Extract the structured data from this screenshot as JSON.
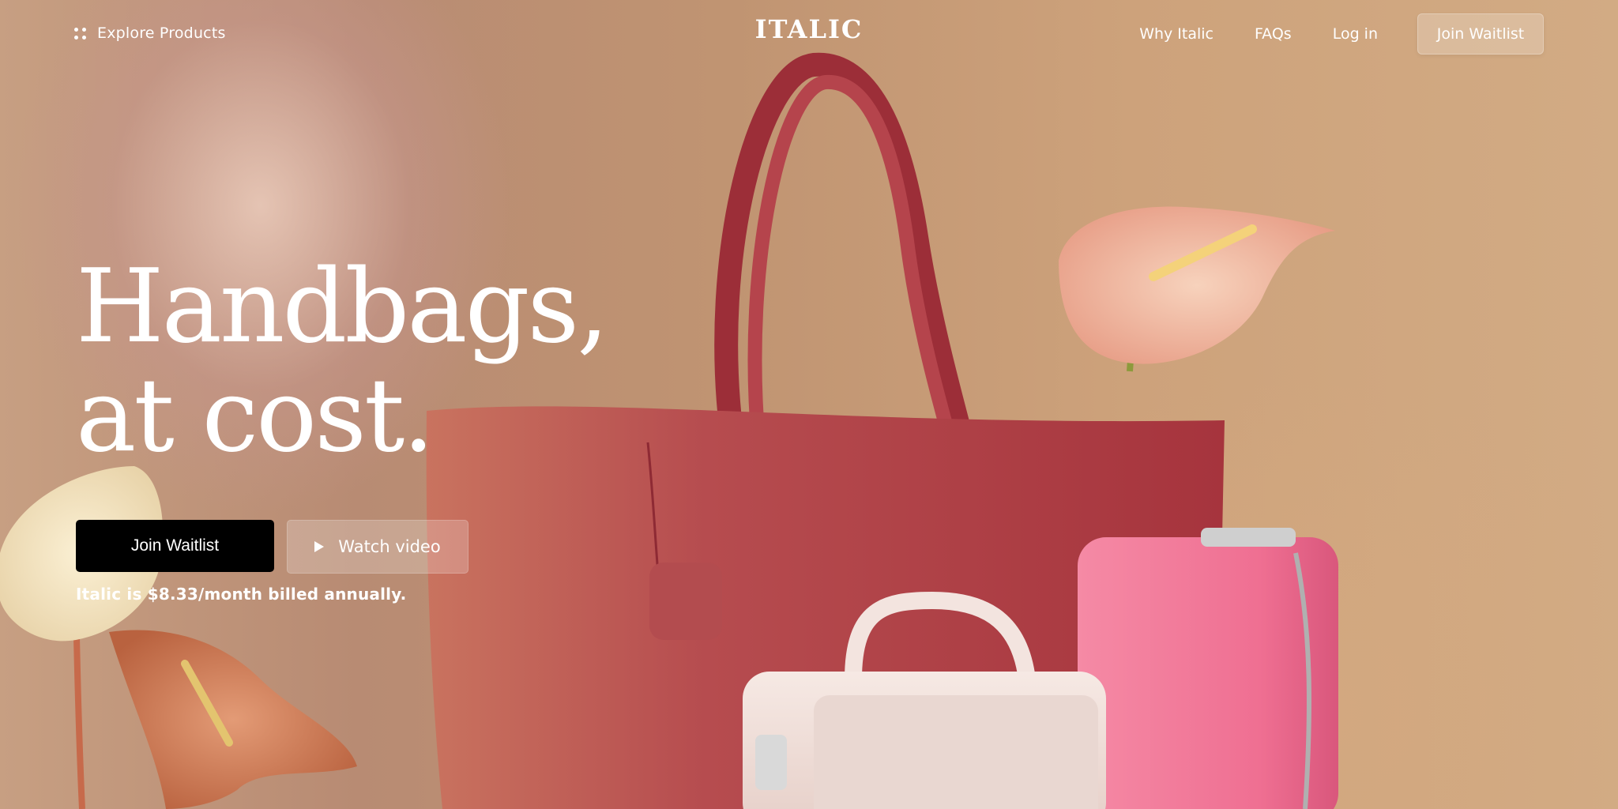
{
  "nav": {
    "explore_label": "Explore Products",
    "logo": "ITALIC",
    "links": [
      {
        "label": "Why Italic"
      },
      {
        "label": "FAQs"
      },
      {
        "label": "Log in"
      }
    ],
    "cta_label": "Join Waitlist"
  },
  "hero": {
    "headline_line1": "Handbags,",
    "headline_line2": "at cost.",
    "primary_button": "Join Waitlist",
    "secondary_button": "Watch video",
    "pricing_note": "Italic is $8.33/month billed annually."
  },
  "colors": {
    "background": "#c39a78",
    "tote_bag": "#b4474e",
    "pink_bag": "#f27a99",
    "white_bag": "#efdcd6",
    "anthurium": "#f1b8a0",
    "primary_button_bg": "#000000"
  },
  "icons": {
    "explore": "grid-dots-icon",
    "watch_video": "play-icon"
  }
}
